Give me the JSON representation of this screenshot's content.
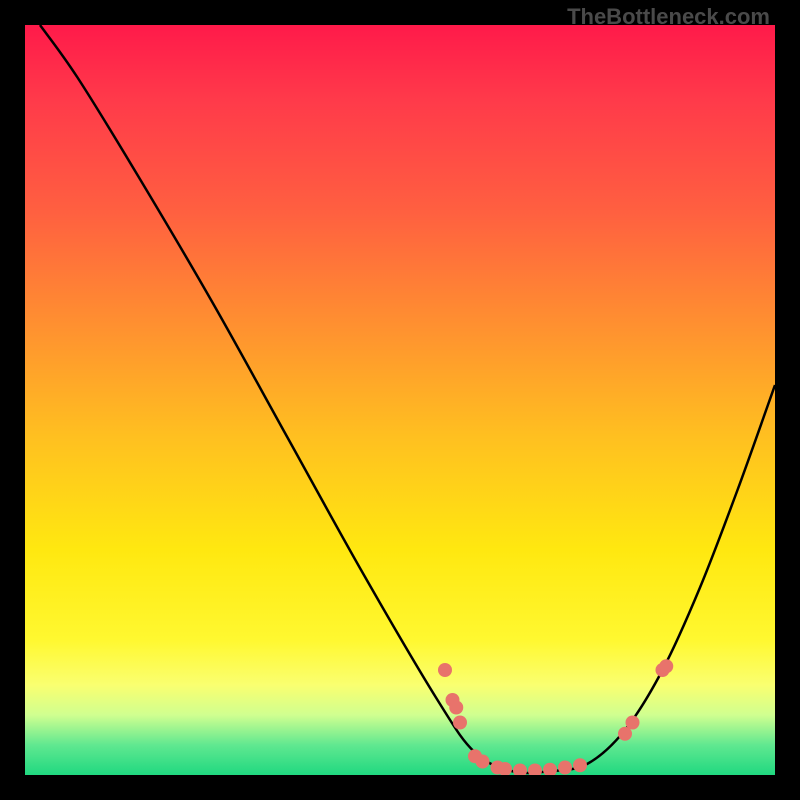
{
  "watermark": "TheBottleneck.com",
  "chart_data": {
    "type": "line",
    "title": "",
    "xlabel": "",
    "ylabel": "",
    "xlim": [
      0,
      100
    ],
    "ylim": [
      0,
      100
    ],
    "curve_points": [
      {
        "x": 2,
        "y": 100
      },
      {
        "x": 7,
        "y": 93
      },
      {
        "x": 15,
        "y": 80
      },
      {
        "x": 25,
        "y": 63
      },
      {
        "x": 35,
        "y": 45
      },
      {
        "x": 45,
        "y": 27
      },
      {
        "x": 55,
        "y": 10
      },
      {
        "x": 60,
        "y": 3
      },
      {
        "x": 65,
        "y": 0.5
      },
      {
        "x": 70,
        "y": 0.5
      },
      {
        "x": 75,
        "y": 1.5
      },
      {
        "x": 80,
        "y": 6
      },
      {
        "x": 85,
        "y": 14
      },
      {
        "x": 90,
        "y": 25
      },
      {
        "x": 95,
        "y": 38
      },
      {
        "x": 100,
        "y": 52
      }
    ],
    "scatter_points": [
      {
        "x": 56,
        "y": 14
      },
      {
        "x": 57,
        "y": 10
      },
      {
        "x": 57.5,
        "y": 9
      },
      {
        "x": 58,
        "y": 7
      },
      {
        "x": 60,
        "y": 2.5
      },
      {
        "x": 61,
        "y": 1.8
      },
      {
        "x": 63,
        "y": 1
      },
      {
        "x": 64,
        "y": 0.8
      },
      {
        "x": 66,
        "y": 0.6
      },
      {
        "x": 68,
        "y": 0.6
      },
      {
        "x": 70,
        "y": 0.7
      },
      {
        "x": 72,
        "y": 1
      },
      {
        "x": 74,
        "y": 1.3
      },
      {
        "x": 80,
        "y": 5.5
      },
      {
        "x": 81,
        "y": 7
      },
      {
        "x": 85,
        "y": 14
      },
      {
        "x": 85.5,
        "y": 14.5
      }
    ],
    "colors": {
      "curve": "#000000",
      "markers": "#e8736b",
      "gradient_top": "#ff1a4a",
      "gradient_bottom": "#20d880"
    }
  }
}
